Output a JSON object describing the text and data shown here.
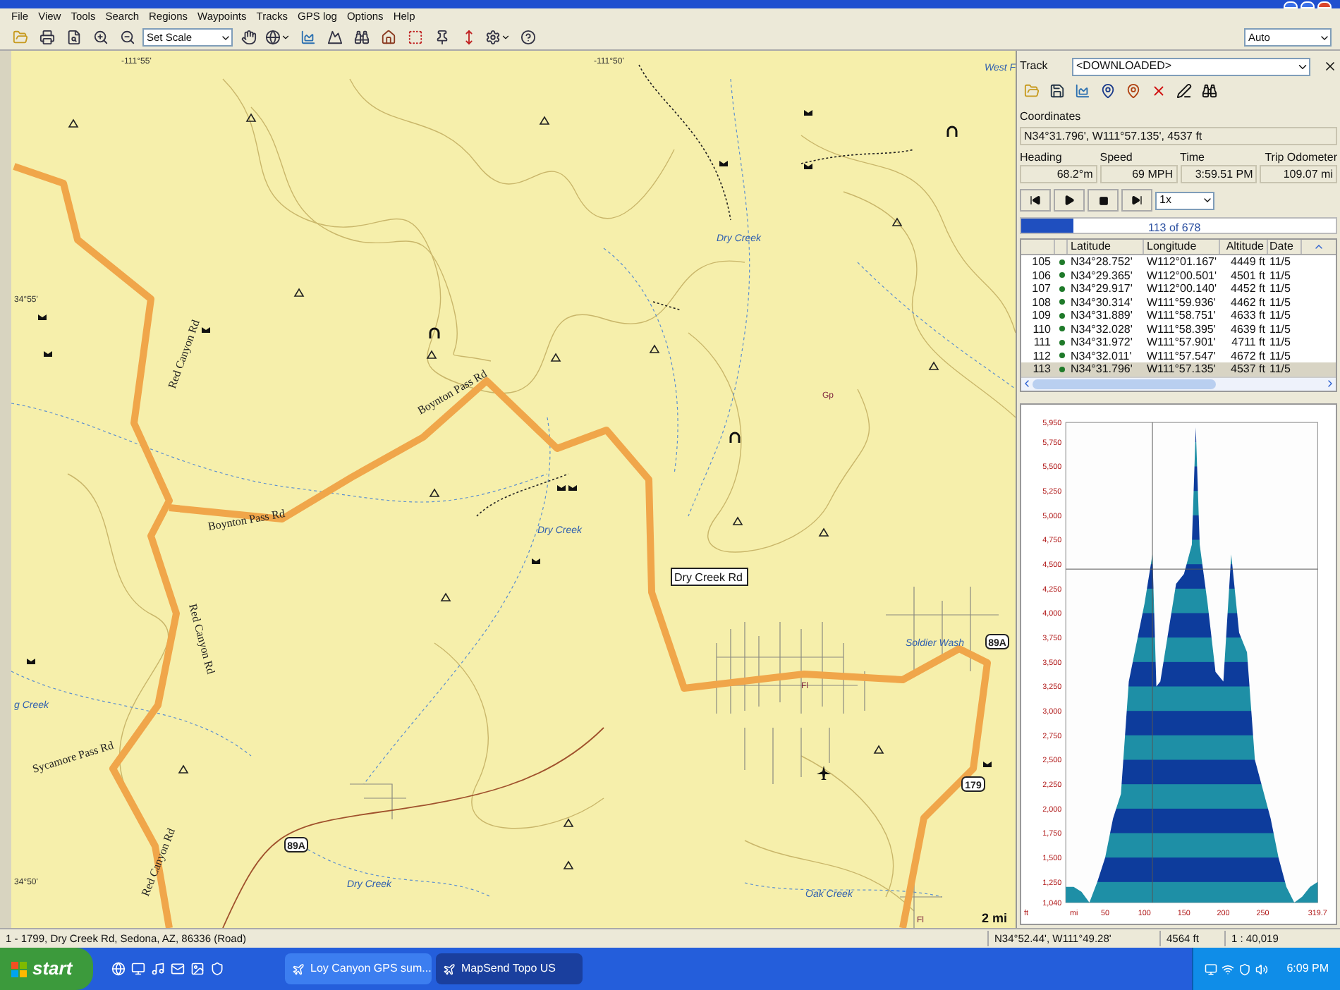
{
  "menu": [
    "File",
    "View",
    "Tools",
    "Search",
    "Regions",
    "Waypoints",
    "Tracks",
    "GPS log",
    "Options",
    "Help"
  ],
  "toolbar": {
    "scale_select": "Set Scale",
    "zoom_select": "Auto"
  },
  "map": {
    "labels": [
      {
        "text": "-111°55'",
        "kind": "grid"
      },
      {
        "text": "-111°50'",
        "kind": "grid"
      },
      {
        "text": "West F",
        "kind": "creek"
      },
      {
        "text": "34°55'",
        "kind": "grid"
      },
      {
        "text": "Dry Creek",
        "kind": "creek"
      },
      {
        "text": "Red Canyon Rd",
        "kind": "road"
      },
      {
        "text": "Boynton Pass Rd",
        "kind": "road"
      },
      {
        "text": "Gp",
        "kind": "place"
      },
      {
        "text": "Boynton Pass Rd",
        "kind": "road"
      },
      {
        "text": "Dry Creek",
        "kind": "creek"
      },
      {
        "text": "Dry Creek Rd",
        "kind": "callout"
      },
      {
        "text": "Red Canyon Rd",
        "kind": "road"
      },
      {
        "text": "Soldier Wash",
        "kind": "creek"
      },
      {
        "text": "89A",
        "kind": "shield"
      },
      {
        "text": "g Creek",
        "kind": "creek"
      },
      {
        "text": "Fl",
        "kind": "place"
      },
      {
        "text": "Sycamore Pass Rd",
        "kind": "road"
      },
      {
        "text": "179",
        "kind": "shield"
      },
      {
        "text": "89A",
        "kind": "shield"
      },
      {
        "text": "Red Canyon Rd",
        "kind": "road"
      },
      {
        "text": "Dry Creek",
        "kind": "creek"
      },
      {
        "text": "34°50'",
        "kind": "grid"
      },
      {
        "text": "Oak Creek",
        "kind": "creek"
      },
      {
        "text": "Fl",
        "kind": "place"
      },
      {
        "text": "2 mi",
        "kind": "scale"
      }
    ]
  },
  "track_panel": {
    "track_label": "Track",
    "track_value": "<DOWNLOADED>",
    "coordinates_label": "Coordinates",
    "coordinates_value": "N34°31.796', W111°57.135', 4537 ft",
    "readouts": [
      {
        "label": "Heading",
        "value": "68.2°m"
      },
      {
        "label": "Speed",
        "value": "69 MPH"
      },
      {
        "label": "Time",
        "value": "3:59.51 PM"
      },
      {
        "label": "Trip Odometer",
        "value": "109.07 mi"
      }
    ],
    "playback_speed": "1x",
    "progress": {
      "text": "113 of 678",
      "level": 0.167
    },
    "table": {
      "columns": [
        "Latitude",
        "Longitude",
        "Altitude",
        "Date"
      ],
      "rows": [
        {
          "index": "105",
          "color": "#1f7a2a",
          "cells": [
            "N34°28.752'",
            "W112°01.167'",
            "4449 ft",
            "11/5"
          ],
          "selected": false
        },
        {
          "index": "106",
          "color": "#1f7a2a",
          "cells": [
            "N34°29.365'",
            "W112°00.501'",
            "4501 ft",
            "11/5"
          ],
          "selected": false
        },
        {
          "index": "107",
          "color": "#1f7a2a",
          "cells": [
            "N34°29.917'",
            "W112°00.140'",
            "4452 ft",
            "11/5"
          ],
          "selected": false
        },
        {
          "index": "108",
          "color": "#1f7a2a",
          "cells": [
            "N34°30.314'",
            "W111°59.936'",
            "4462 ft",
            "11/5"
          ],
          "selected": false
        },
        {
          "index": "109",
          "color": "#1f7a2a",
          "cells": [
            "N34°31.889'",
            "W111°58.751'",
            "4633 ft",
            "11/5"
          ],
          "selected": false
        },
        {
          "index": "110",
          "color": "#1f7a2a",
          "cells": [
            "N34°32.028'",
            "W111°58.395'",
            "4639 ft",
            "11/5"
          ],
          "selected": false
        },
        {
          "index": "111",
          "color": "#1f7a2a",
          "cells": [
            "N34°31.972'",
            "W111°57.901'",
            "4711 ft",
            "11/5"
          ],
          "selected": false
        },
        {
          "index": "112",
          "color": "#1f7a2a",
          "cells": [
            "N34°32.011'",
            "W111°57.547'",
            "4672 ft",
            "11/5"
          ],
          "selected": false
        },
        {
          "index": "113",
          "color": "#1f7a2a",
          "cells": [
            "N34°31.796'",
            "W111°57.135'",
            "4537 ft",
            "11/5"
          ],
          "selected": true
        }
      ]
    },
    "profile": {
      "chart_data": {
        "type": "area",
        "xlabel": "mi",
        "ylabel": "ft",
        "x": [
          0,
          10,
          20,
          30,
          40,
          50,
          60,
          70,
          80,
          90,
          100,
          110,
          115,
          120,
          130,
          140,
          150,
          160,
          165,
          170,
          180,
          190,
          200,
          210,
          220,
          230,
          240,
          250,
          260,
          270,
          280,
          290,
          300,
          310,
          319.7
        ],
        "series": [
          {
            "color": "#1e8fa6",
            "values": [
              1200,
              1200,
              1150,
              1040,
              1250,
              1500,
              1900,
              2150,
              3300,
              3700,
              4100,
              4600,
              3250,
              3300,
              3800,
              4300,
              4400,
              4700,
              5900,
              4700,
              4100,
              3400,
              3300,
              4600,
              3800,
              3600,
              2500,
              2200,
              1900,
              1500,
              1200,
              1040,
              1100,
              1200,
              1250
            ]
          }
        ],
        "xlim": [
          0,
          319.7
        ],
        "ylim": [
          1040,
          5950
        ],
        "xticks": [
          50,
          100,
          150,
          200,
          250,
          319.7
        ],
        "yticks": [
          {
            "value": 1040,
            "label": "1,040"
          },
          {
            "value": 1250,
            "label": "1,250"
          },
          {
            "value": 1500,
            "label": "1,500"
          },
          {
            "value": 1750,
            "label": "1,750"
          },
          {
            "value": 2000,
            "label": "2,000"
          },
          {
            "value": 2250,
            "label": "2,250"
          },
          {
            "value": 2500,
            "label": "2,500"
          },
          {
            "value": 2750,
            "label": "2,750"
          },
          {
            "value": 3000,
            "label": "3,000"
          },
          {
            "value": 3250,
            "label": "3,250"
          },
          {
            "value": 3500,
            "label": "3,500"
          },
          {
            "value": 3750,
            "label": "3,750"
          },
          {
            "value": 4000,
            "label": "4,000"
          },
          {
            "value": 4250,
            "label": "4,250"
          },
          {
            "value": 4500,
            "label": "4,500"
          },
          {
            "value": 4750,
            "label": "4,750"
          },
          {
            "value": 5000,
            "label": "5,000"
          },
          {
            "value": 5250,
            "label": "5,250"
          },
          {
            "value": 5500,
            "label": "5,500"
          },
          {
            "value": 5750,
            "label": "5,750"
          },
          {
            "value": 5950,
            "label": "5,950"
          }
        ],
        "ref_lines": [
          {
            "axis": "x",
            "value": 110
          },
          {
            "axis": "y",
            "value": 4450
          }
        ]
      }
    }
  },
  "status_bar": {
    "address": "1 - 1799, Dry Creek Rd, Sedona, AZ, 86336 (Road)",
    "position": "N34°52.44', W111°49.28'",
    "elevation": "4564 ft",
    "scale": "1 : 40,019"
  },
  "taskbar": {
    "start": "start",
    "tasks": [
      {
        "label": "Loy Canyon GPS sum...",
        "selected": false
      },
      {
        "label": "MapSend Topo US",
        "selected": true
      }
    ],
    "clock": "6:09 PM"
  }
}
